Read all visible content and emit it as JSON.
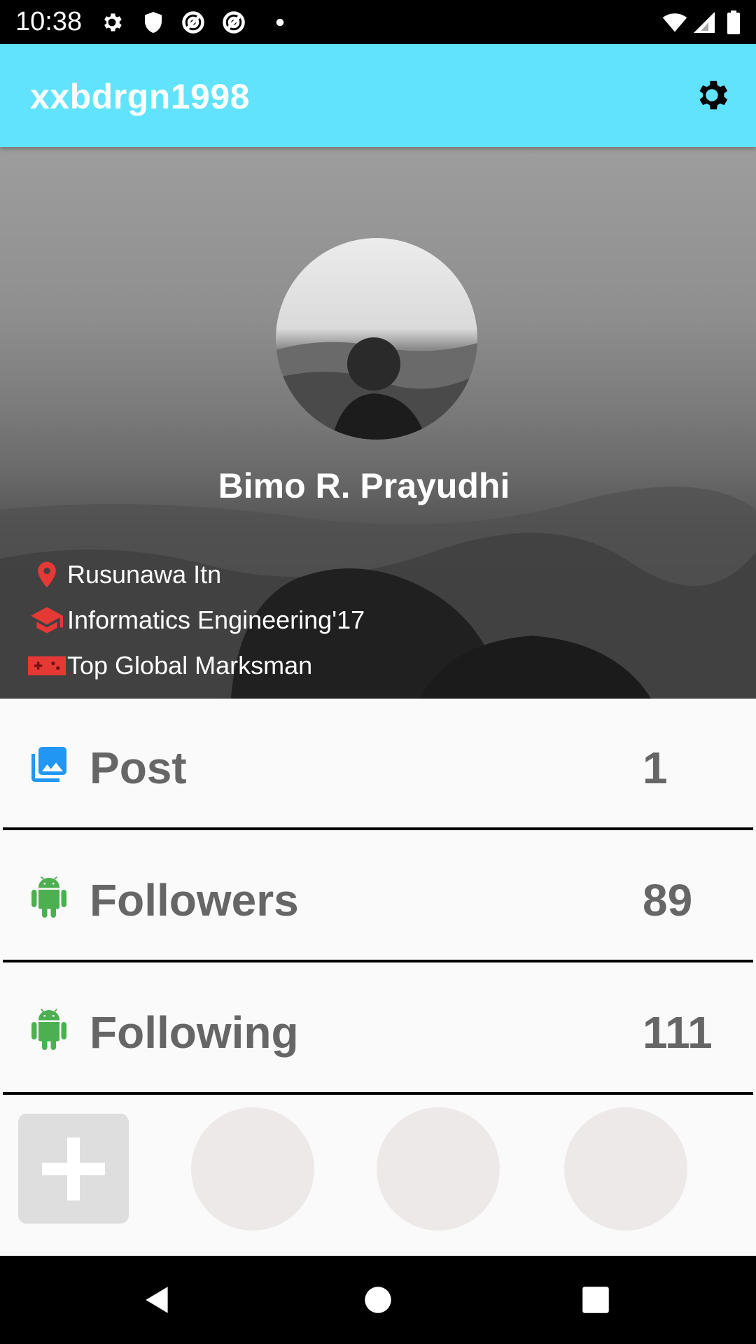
{
  "status_bar": {
    "time": "10:38",
    "icons": [
      "settings-icon",
      "shield-icon",
      "at-sign-icon",
      "at-sign-icon",
      "dot-icon",
      "wifi-icon",
      "signal-icon",
      "battery-icon"
    ]
  },
  "app_bar": {
    "title": "xxbdrgn1998",
    "settings_icon": "gear-icon"
  },
  "profile": {
    "name": "Bimo R. Prayudhi",
    "info": [
      {
        "icon": "location-pin-icon",
        "text": "Rusunawa Itn",
        "color": "#e53935"
      },
      {
        "icon": "graduation-cap-icon",
        "text": "Informatics Engineering'17",
        "color": "#e53935"
      },
      {
        "icon": "gamepad-icon",
        "text": "Top Global Marksman",
        "color": "#e53935"
      }
    ]
  },
  "stats": [
    {
      "icon": "photo-icon",
      "label": "Post",
      "value": "1",
      "icon_color": "#2196f3"
    },
    {
      "icon": "android-icon",
      "label": "Followers",
      "value": "89",
      "icon_color": "#4caf50"
    },
    {
      "icon": "android-icon",
      "label": "Following",
      "value": "111",
      "icon_color": "#4caf50"
    }
  ],
  "colors": {
    "app_bar": "#61e3fd",
    "background": "#fafafa",
    "stat_text": "#666666"
  },
  "nav_bar": {
    "icons": [
      "back-icon",
      "home-icon",
      "recents-icon"
    ]
  }
}
